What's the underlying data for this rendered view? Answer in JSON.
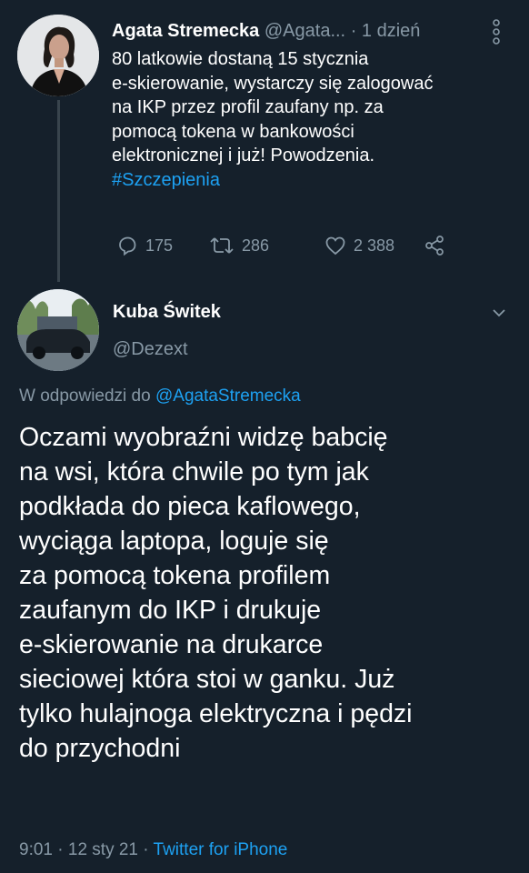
{
  "tweet": {
    "author_name": "Agata Stremecka",
    "author_handle": "@Agata...",
    "time_sep": "·",
    "time": "1 dzień",
    "text_lines": [
      "80 latkowie dostaną 15 stycznia",
      "e-skierowanie, wystarczy się zalogować",
      "na IKP przez profil zaufany np. za",
      "pomocą tokena w bankowości",
      "elektronicznej i już! Powodzenia."
    ],
    "hashtag": "#Szczepienia",
    "reply_count": "175",
    "retweet_count": "286",
    "like_count": "2 388"
  },
  "reply": {
    "author_name": "Kuba Świtek",
    "author_handle": "@Dezext",
    "replying_to_prefix": "W odpowiedzi do",
    "replying_to_handle": "@AgataStremecka",
    "text_lines": [
      "Oczami wyobraźni widzę babcię",
      "na wsi, która chwile po tym jak",
      "podkłada do pieca kaflowego,",
      "wyciąga laptopa, loguje się",
      "za pomocą tokena profilem",
      "zaufanym do IKP i drukuje",
      "e-skierowanie na drukarce",
      "sieciowej która stoi w ganku. Już",
      "tylko hulajnoga elektryczna i pędzi",
      "do przychodni"
    ],
    "time": "9:01",
    "sep1": "·",
    "date": "12 sty 21",
    "sep2": "·",
    "source": "Twitter for iPhone"
  },
  "colors": {
    "background": "#15202b",
    "text": "#ffffff",
    "muted": "#8899a6",
    "accent": "#1da1f2"
  },
  "icons": [
    "reply-icon",
    "retweet-icon",
    "like-icon",
    "share-icon",
    "more-icon",
    "chevron-down-icon"
  ]
}
